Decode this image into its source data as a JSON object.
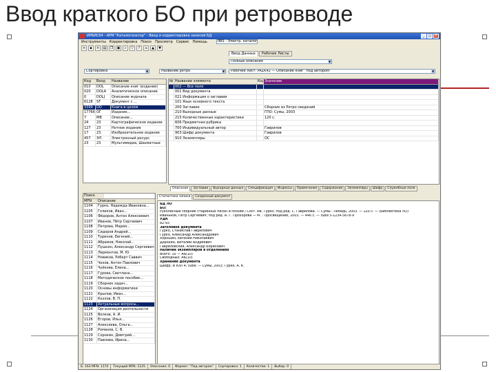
{
  "slide": {
    "title": "Ввод краткого БО при ретровводе"
  },
  "window": {
    "title": "ИРБИС64 - АРМ \"Каталогизатор\" - Ввод и корректировка записей БД",
    "controls": [
      "_",
      "□",
      "×"
    ],
    "menu": [
      "Инструменты",
      "Корректировка",
      "Поиск",
      "Просмотр",
      "Сервис",
      "Помощь"
    ],
    "db_selector": "IBIS - Электр. каталог",
    "toolbar_icons": [
      "new-icon",
      "save-icon",
      "delete-icon",
      "print-icon",
      "copy-icon",
      "paste-icon",
      "find-icon",
      "filter-icon",
      "help-icon",
      "home-icon",
      "up-icon",
      "down-icon"
    ],
    "worksheet_tabs": [
      "Ввод Данных",
      "Рабочие Листы"
    ],
    "mode_select": "Полные описания",
    "param_select": "Название ретро",
    "worksheet_field": "Рабочий лист: PAZK42 — Описание книг \"под автором\"",
    "sort_field": "Сортировка"
  },
  "index_list": {
    "headers": [
      "Код",
      "Вход",
      "Название"
    ],
    "rows": [
      [
        "010",
        "DOL",
        "Описание книг (издание)"
      ],
      [
        "020",
        "DOLA",
        "Аналитическое описание"
      ],
      [
        "0",
        "DOLJ",
        "Описание журнала"
      ],
      [
        "6128",
        "ST",
        "Документ с ..."
      ],
      [
        "3399",
        "DO",
        "Книга в целом"
      ],
      [
        "17766",
        "ОГ",
        "Издание..."
      ],
      [
        "7",
        "МВ",
        "Описание..."
      ],
      [
        "24",
        "23",
        "Картографическое издание"
      ],
      [
        "127",
        "23",
        "Нотное издание"
      ],
      [
        "17",
        "23",
        "Изобразительное издание"
      ],
      [
        "457",
        "ЭЛ",
        "Электронный ресурс"
      ],
      [
        "23",
        "23",
        "Мультимедиа, Шахматные"
      ]
    ]
  },
  "fields_table": {
    "headers": [
      "№",
      "Название элемента",
      "Код",
      "Значение"
    ],
    "rows": [
      [
        "",
        "002 — Все поля",
        "",
        ""
      ],
      [
        "",
        "001 Вид документа",
        "",
        ""
      ],
      [
        "",
        "021 Информация о заглавии",
        "",
        ""
      ],
      [
        "",
        "101 Язык основного текста",
        "",
        ""
      ],
      [
        "",
        "200 Заглавие",
        "",
        "Сборник из Ретро сведений"
      ],
      [
        "",
        "210 Выходные данные",
        "",
        "ГПО: Сумы, 2003"
      ],
      [
        "",
        "215 Количественные характеристики",
        "",
        "120 с."
      ],
      [
        "",
        "606 Предметная рубрика",
        "",
        ""
      ],
      [
        "",
        "700 Индивидуальный автор",
        "",
        "Гаврилов"
      ],
      [
        "",
        "903 Шифр документа",
        "",
        "Гаврилов"
      ],
      [
        "",
        "910 Экземпляры",
        "",
        "ОС"
      ]
    ]
  },
  "sheet_tabs": [
    "Описание",
    "Заглавие",
    "Выходные данные",
    "Спецификация",
    "Индексы",
    "Примечание",
    "Содержание",
    "Экземпляры",
    "Шифр",
    "Служебные поля"
  ],
  "record_list": {
    "search_label": "Поиск",
    "headers": [
      "MFN",
      "Описание"
    ],
    "rows": [
      [
        "1104",
        "Гурко, Надежда Ивановна..."
      ],
      [
        "1105",
        "Голиков, Иван..."
      ],
      [
        "1106",
        "Фёдоров, Антон Алексеевич"
      ],
      [
        "1107",
        "Иванов, Пётр Сергеевич"
      ],
      [
        "1108",
        "Петрова, Мария..."
      ],
      [
        "1109",
        "Сидоров Андрей..."
      ],
      [
        "1110",
        "Туринов, Евгений..."
      ],
      [
        "1111",
        "Абрамов, Николай..."
      ],
      [
        "1112",
        "Пушкин, Александр Сергеевич"
      ],
      [
        "1113",
        "Лермонтов, М. Ю."
      ],
      [
        "1114",
        "Новиков, Роберт Саввич"
      ],
      [
        "1115",
        "Чехов, Антон Павлович"
      ],
      [
        "1116",
        "Чуйкова, Елена..."
      ],
      [
        "1117",
        "Гурова, Светлана..."
      ],
      [
        "1118",
        "Методическое пособие..."
      ],
      [
        "1119",
        "Сборник задач..."
      ],
      [
        "1120",
        "Основы информатики"
      ],
      [
        "1121",
        "Крылов, Иван..."
      ],
      [
        "1122",
        "Козлов, В. П."
      ],
      [
        "1123",
        "Актуальные вопросы..."
      ],
      [
        "1124",
        "Организация деятельности"
      ],
      [
        "1125",
        "Волков, А. И."
      ],
      [
        "1126",
        "Егоров, Илья..."
      ],
      [
        "1127",
        "Алексеева, Ольга..."
      ],
      [
        "1128",
        "Романов, С. В."
      ],
      [
        "1129",
        "Сорокин, Дмитрий..."
      ],
      [
        "1130",
        "Павлова, Ирина..."
      ]
    ],
    "selected_index": 19
  },
  "doc_tabs": [
    "Статистика записи",
    "Созданный документ"
  ],
  "document": {
    "lines": [
      {
        "text": "БД  ЛО",
        "bold": true
      },
      {
        "text": "БО:",
        "bold": true
      },
      {
        "text": "Рукописный сборник старинных песен и поэзий / Сост. Ив. Гурко; под ред. С. Гаврилова. — Сумы : Лебедь, 2003. — 120 с. — (Библиотека ЛО)",
        "bold": false
      },
      {
        "text": "Иваньков, Пётр Сергеевич; под ред. А. Г. Прохорова — М. : Просвещение, 2003. — 446 с. — ISBN 5-1234-5678-9",
        "bold": false
      },
      {
        "text": "УДК",
        "bold": true
      },
      {
        "text": "82-93",
        "bold": false
      },
      {
        "text": "Заголовок документа",
        "bold": true
      },
      {
        "text": "Гурко, Станислав Гаврилович",
        "bold": false
      },
      {
        "text": "Гурко, Александр Александрович",
        "bold": false
      },
      {
        "text": "Хорошин, Евгений Николаевич",
        "bold": false
      },
      {
        "text": "Дорохин, Виталий Андреевич",
        "bold": false
      },
      {
        "text": "Гавриловский, Александр Борисович",
        "bold": false
      },
      {
        "text": "Наличие экземпляров в отделениях",
        "bold": true
      },
      {
        "text": "Всего: 10 — АБ(10)",
        "bold": false
      },
      {
        "text": "Свободных: АБ(10)",
        "bold": false
      },
      {
        "text": "Хранение документа",
        "bold": true
      },
      {
        "text": "Шифр: И Кл/Г4; ISBN: — Сумы, 2003; Гурко, А. К.",
        "bold": false
      }
    ]
  },
  "status_bar": [
    "Б: 163 MFN: 1174",
    "Текущий MFN: 1125",
    "Описание: 0",
    "Формат: \"Под автором\"",
    "Сортировка: 1",
    "Количество: 1",
    "Выбор: 0"
  ]
}
